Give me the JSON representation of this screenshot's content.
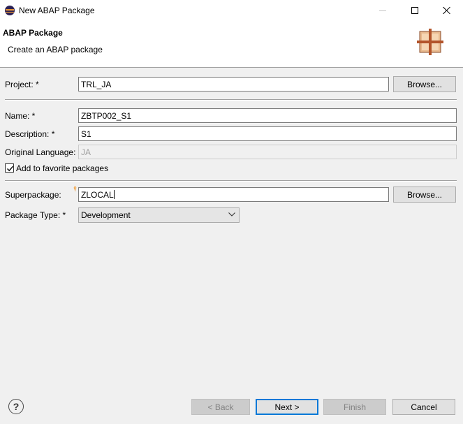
{
  "window": {
    "title": "New ABAP Package",
    "icon": "eclipse-icon"
  },
  "banner": {
    "title": "ABAP Package",
    "description": "Create an ABAP package",
    "icon": "package-icon"
  },
  "form": {
    "project": {
      "label": "Project: *",
      "value": "TRL_JA",
      "browse_label": "Browse..."
    },
    "name": {
      "label": "Name: *",
      "value": "ZBTP002_S1"
    },
    "description": {
      "label": "Description: *",
      "value": "S1"
    },
    "original_language": {
      "label": "Original Language:",
      "value": "JA"
    },
    "favorites": {
      "label": "Add to favorite packages",
      "checked": true
    },
    "superpackage": {
      "label": "Superpackage:",
      "value": "ZLOCAL",
      "browse_label": "Browse..."
    },
    "package_type": {
      "label": "Package Type: *",
      "selected": "Development"
    }
  },
  "footer": {
    "help_label": "?",
    "back_label": "< Back",
    "next_label": "Next >",
    "finish_label": "Finish",
    "cancel_label": "Cancel"
  },
  "colors": {
    "accent": "#0078d7",
    "required_marker": "#f39c33"
  }
}
